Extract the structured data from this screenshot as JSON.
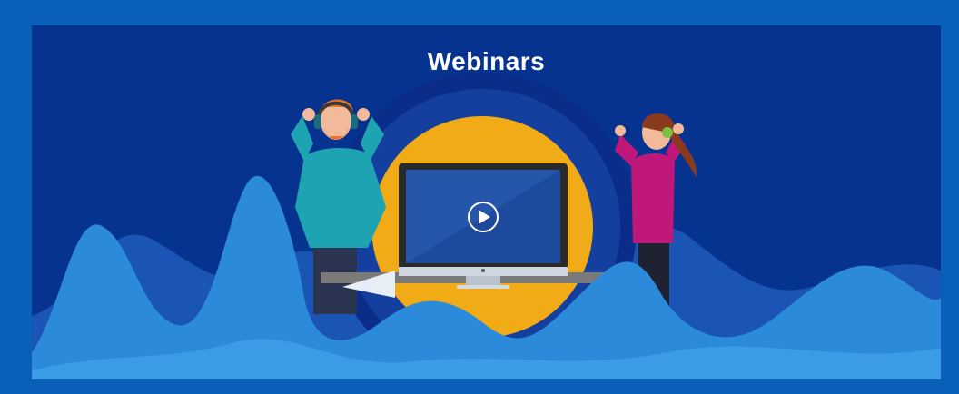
{
  "banner": {
    "title": "Webinars"
  },
  "colors": {
    "frame": "#0a5fb8",
    "background": "#063290",
    "wave_back": "#1a55b5",
    "wave_front": "#2b8ad9",
    "circle": "#f0ab16",
    "screen": "#1d4a9c"
  },
  "icons": {
    "play": "play-icon",
    "laptop": "monitor-icon"
  }
}
